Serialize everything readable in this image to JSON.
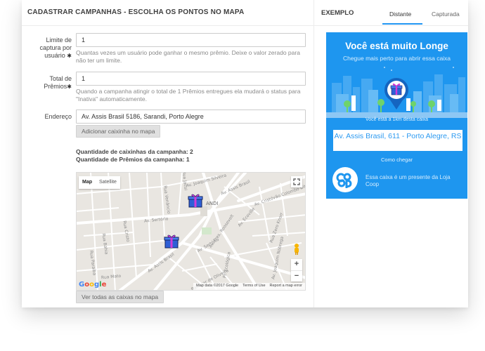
{
  "left": {
    "title": "CADASTRAR CAMPANHAS - ESCOLHA OS PONTOS NO MAPA",
    "fields": {
      "limite": {
        "label_lines": [
          "Limite de",
          "captura por",
          "usuário"
        ],
        "value": "1",
        "help": "Quantas vezes um usuário pode ganhar o mesmo prêmio. Deixe o valor zerado para não ter um limite."
      },
      "total": {
        "label_lines": [
          "Total de",
          "Prêmios"
        ],
        "value": "1",
        "help": "Quando a campanha atingir o total de 1 Prêmios entregues ela mudará o status para \"Inativa\" automaticamente."
      },
      "endereco": {
        "label": "Endereço",
        "value": "Av. Assis Brasil 5186, Sarandi, Porto Alegre"
      }
    },
    "required_mark": "✱",
    "add_button": "Adicionar caixinha no mapa",
    "stats": {
      "boxes": "Quantidade de caixinhas da campanha: 2",
      "prizes": "Quantidade de Prêmios da campanha: 1"
    },
    "map": {
      "tab_map": "Map",
      "tab_satellite": "Satellite",
      "zoom_in": "+",
      "zoom_out": "−",
      "google": [
        "G",
        "o",
        "o",
        "g",
        "l",
        "e"
      ],
      "google_colors": [
        "#4285f4",
        "#ea4335",
        "#fbbc05",
        "#4285f4",
        "#34a853",
        "#ea4335"
      ],
      "attribution": [
        "Map data ©2017 Google",
        "Terms of Use",
        "Report a map error"
      ],
      "street_labels": [
        "Av. Assis Brasil",
        "Av. Sertório",
        "Av. Sertório",
        "Av. Assis Brasil",
        "Av. Baltazar de Oliveira",
        "Av. Ecoville",
        "Av. Cristóvão Colombo Bittencourt",
        "Av. Joaquim Silveira",
        "Rua Cristo",
        "Rua Bahia",
        "Rua Paraíba",
        "Rua Mato",
        "Rua Venâncio",
        "Rua Jacui",
        "Pr. Ecológica",
        "Av. Joaquim Nóbrega",
        "Rua Zero Knorr",
        "Av. Pres. Roosevelt",
        "ANDI"
      ],
      "button": "Ver todas as caixas no mapa"
    }
  },
  "right": {
    "title": "EXEMPLO",
    "tabs": [
      "Distante",
      "Capturada"
    ],
    "active_tab": "Distante",
    "preview": {
      "title": "Você está muito Longe",
      "subtitle": "Chegue mais perto para abrir essa caixa",
      "distance": "Você está a 1km desta caixa",
      "address": "Av. Assis Brasil, 611 - Porto Alegre, RS",
      "how": "Como chegar",
      "logo_letters": "COOP",
      "gift": "Essa caixa é um presente da Loja Coop",
      "bg_color": "#1e96ef"
    }
  }
}
